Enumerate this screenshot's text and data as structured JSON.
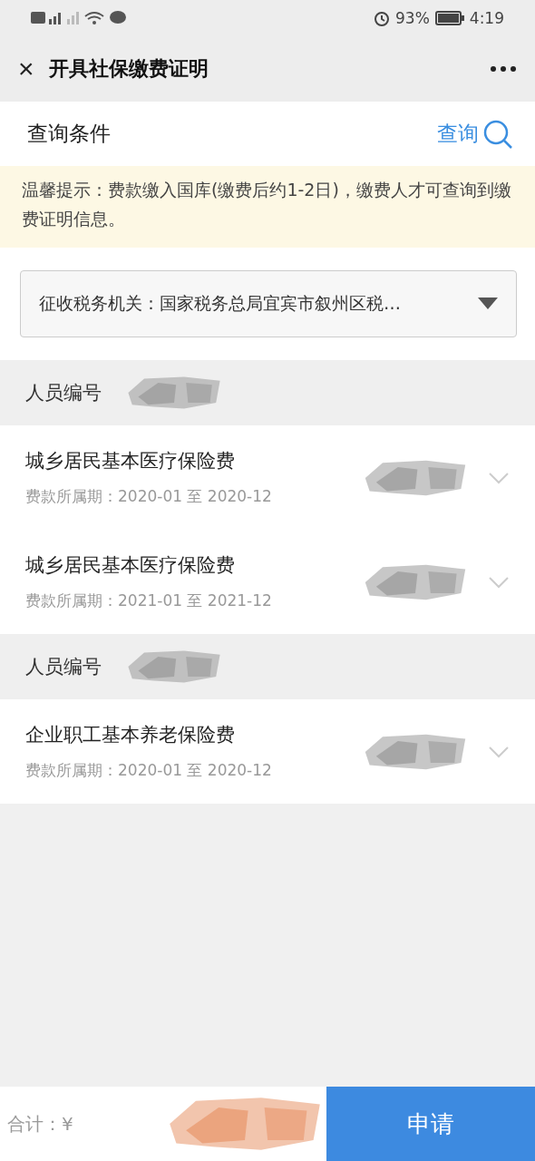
{
  "status_bar": {
    "battery": "93%",
    "time": "4:19"
  },
  "header": {
    "title": "开具社保缴费证明",
    "close": "×"
  },
  "query": {
    "label": "查询条件",
    "button": "查询"
  },
  "notice": "温馨提示：费款缴入国库(缴费后约1-2日)，缴费人才可查询到缴费证明信息。",
  "dropdown": {
    "value": "征收税务机关：国家税务总局宜宾市叙州区税…"
  },
  "groups": [
    {
      "label": "人员编号",
      "items": [
        {
          "name": "城乡居民基本医疗保险费",
          "period": "费款所属期：2020-01 至 2020-12"
        },
        {
          "name": "城乡居民基本医疗保险费",
          "period": "费款所属期：2021-01 至 2021-12"
        }
      ]
    },
    {
      "label": "人员编号",
      "items": [
        {
          "name": "企业职工基本养老保险费",
          "period": "费款所属期：2020-01 至 2020-12"
        }
      ]
    }
  ],
  "footer": {
    "total": "合计：¥",
    "button": "申请"
  }
}
